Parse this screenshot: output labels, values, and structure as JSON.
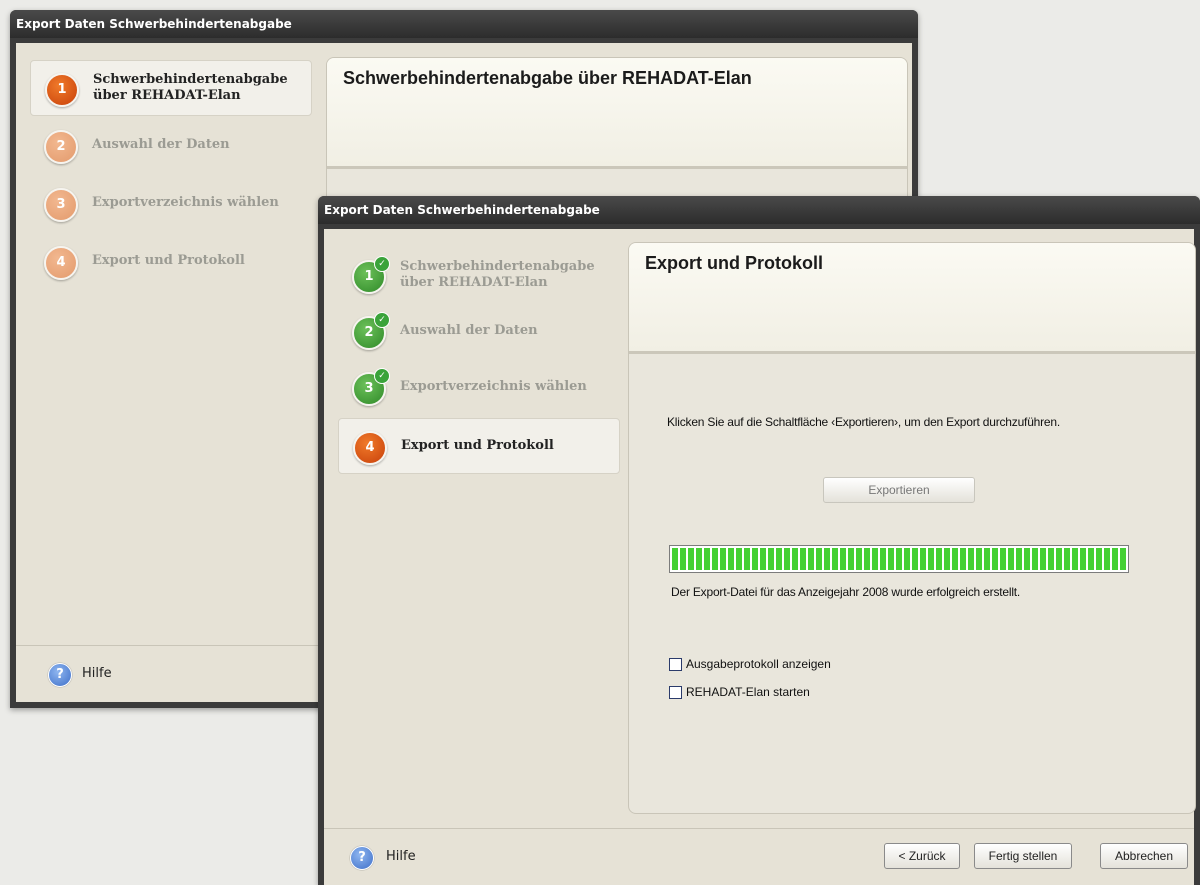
{
  "back_window": {
    "title": "Export Daten Schwerbehindertenabgabe",
    "steps": [
      {
        "num": "1",
        "label": "Schwerbehindertenabgabe über REHADAT-Elan"
      },
      {
        "num": "2",
        "label": "Auswahl der Daten"
      },
      {
        "num": "3",
        "label": "Exportverzeichnis wählen"
      },
      {
        "num": "4",
        "label": "Export und Protokoll"
      }
    ],
    "content_title": "Schwerbehindertenabgabe über REHADAT-Elan",
    "help_label": "Hilfe"
  },
  "front_window": {
    "title": "Export Daten Schwerbehindertenabgabe",
    "steps": [
      {
        "num": "1",
        "label": "Schwerbehindertenabgabe über REHADAT-Elan",
        "done": true
      },
      {
        "num": "2",
        "label": "Auswahl der Daten",
        "done": true
      },
      {
        "num": "3",
        "label": "Exportverzeichnis wählen",
        "done": true
      },
      {
        "num": "4",
        "label": "Export und Protokoll",
        "done": false
      }
    ],
    "content_title": "Export und Protokoll",
    "instruction": "Klicken Sie auf die Schaltfläche ‹Exportieren›, um den Export durchzuführen.",
    "export_button": "Exportieren",
    "progress": 1.0,
    "status_text": "Der Export-Datei für das Anzeigejahr 2008 wurde erfolgreich erstellt.",
    "checkboxes": [
      {
        "label": "Ausgabeprotokoll anzeigen",
        "checked": false
      },
      {
        "label": "REHADAT-Elan starten",
        "checked": false
      }
    ],
    "help_label": "Hilfe",
    "buttons": {
      "back": "< Zurück",
      "finish": "Fertig stellen",
      "cancel": "Abbrechen"
    }
  },
  "colors": {
    "accent": "#d9550f",
    "done": "#3a9a2e",
    "progress": "#44d033"
  }
}
